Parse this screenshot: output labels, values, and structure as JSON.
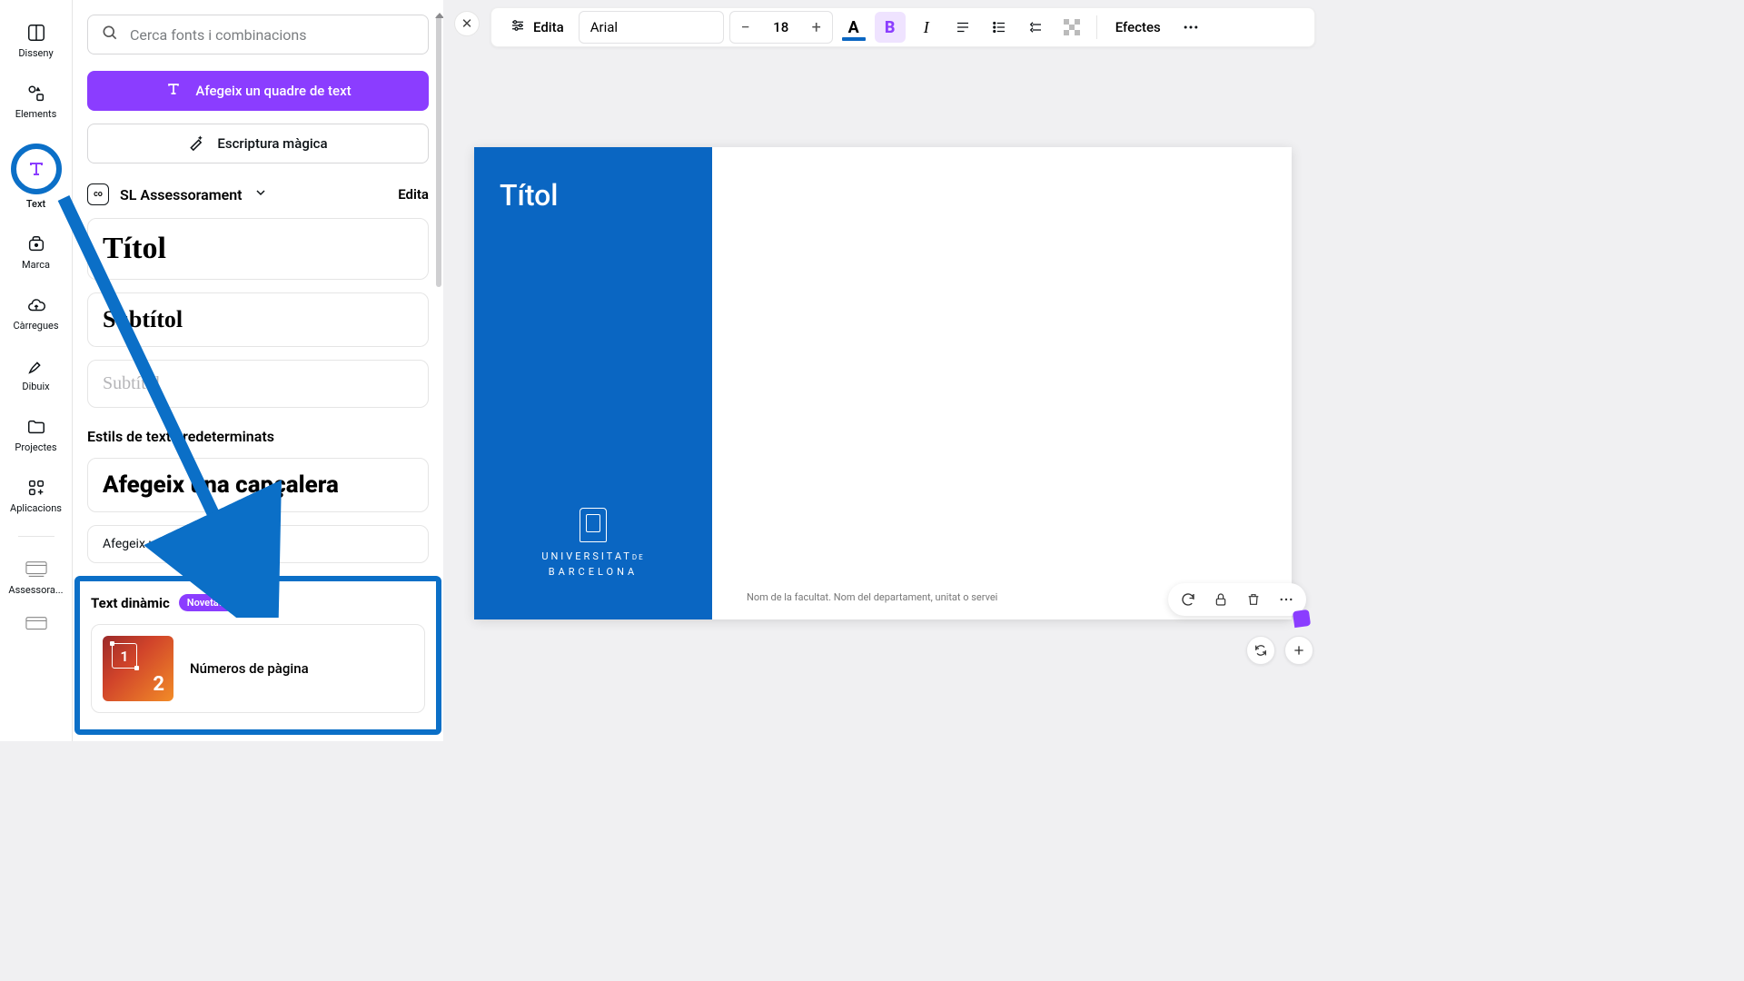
{
  "rail": {
    "items": [
      {
        "label": "Disseny"
      },
      {
        "label": "Elements"
      },
      {
        "label": "Text"
      },
      {
        "label": "Marca"
      },
      {
        "label": "Càrregues"
      },
      {
        "label": "Dibuix"
      },
      {
        "label": "Projectes"
      },
      {
        "label": "Aplicacions"
      },
      {
        "label": "Assessora..."
      }
    ]
  },
  "panel": {
    "search_placeholder": "Cerca fonts i combinacions",
    "add_text_label": "Afegeix un quadre de text",
    "magic_label": "Escriptura màgica",
    "brand_kit_name": "SL Assessorament",
    "brand_edit": "Edita",
    "brand_thumb": "co",
    "styles": {
      "title": "Títol",
      "subtitle": "Subtítol",
      "subtitle2": "Subtítol"
    },
    "default_styles_head": "Estils de text predeterminats",
    "header_preset": "Afegeix una capçalera",
    "body_preset": "Afegeix una mica de text al cos",
    "dynamic": {
      "title": "Text dinàmic",
      "badge": "Novetats",
      "item_label": "Números de pàgina",
      "thumb_num1": "1",
      "thumb_num2": "2"
    }
  },
  "toolbar": {
    "edit": "Edita",
    "font": "Arial",
    "size": "18",
    "effects": "Efectes"
  },
  "canvas": {
    "title": "Títol",
    "uni_line1": "UNIVERSITAT",
    "uni_de": "DE",
    "uni_line2": "BARCELONA",
    "footer": "Nom de la facultat. Nom del departament, unitat o servei"
  }
}
